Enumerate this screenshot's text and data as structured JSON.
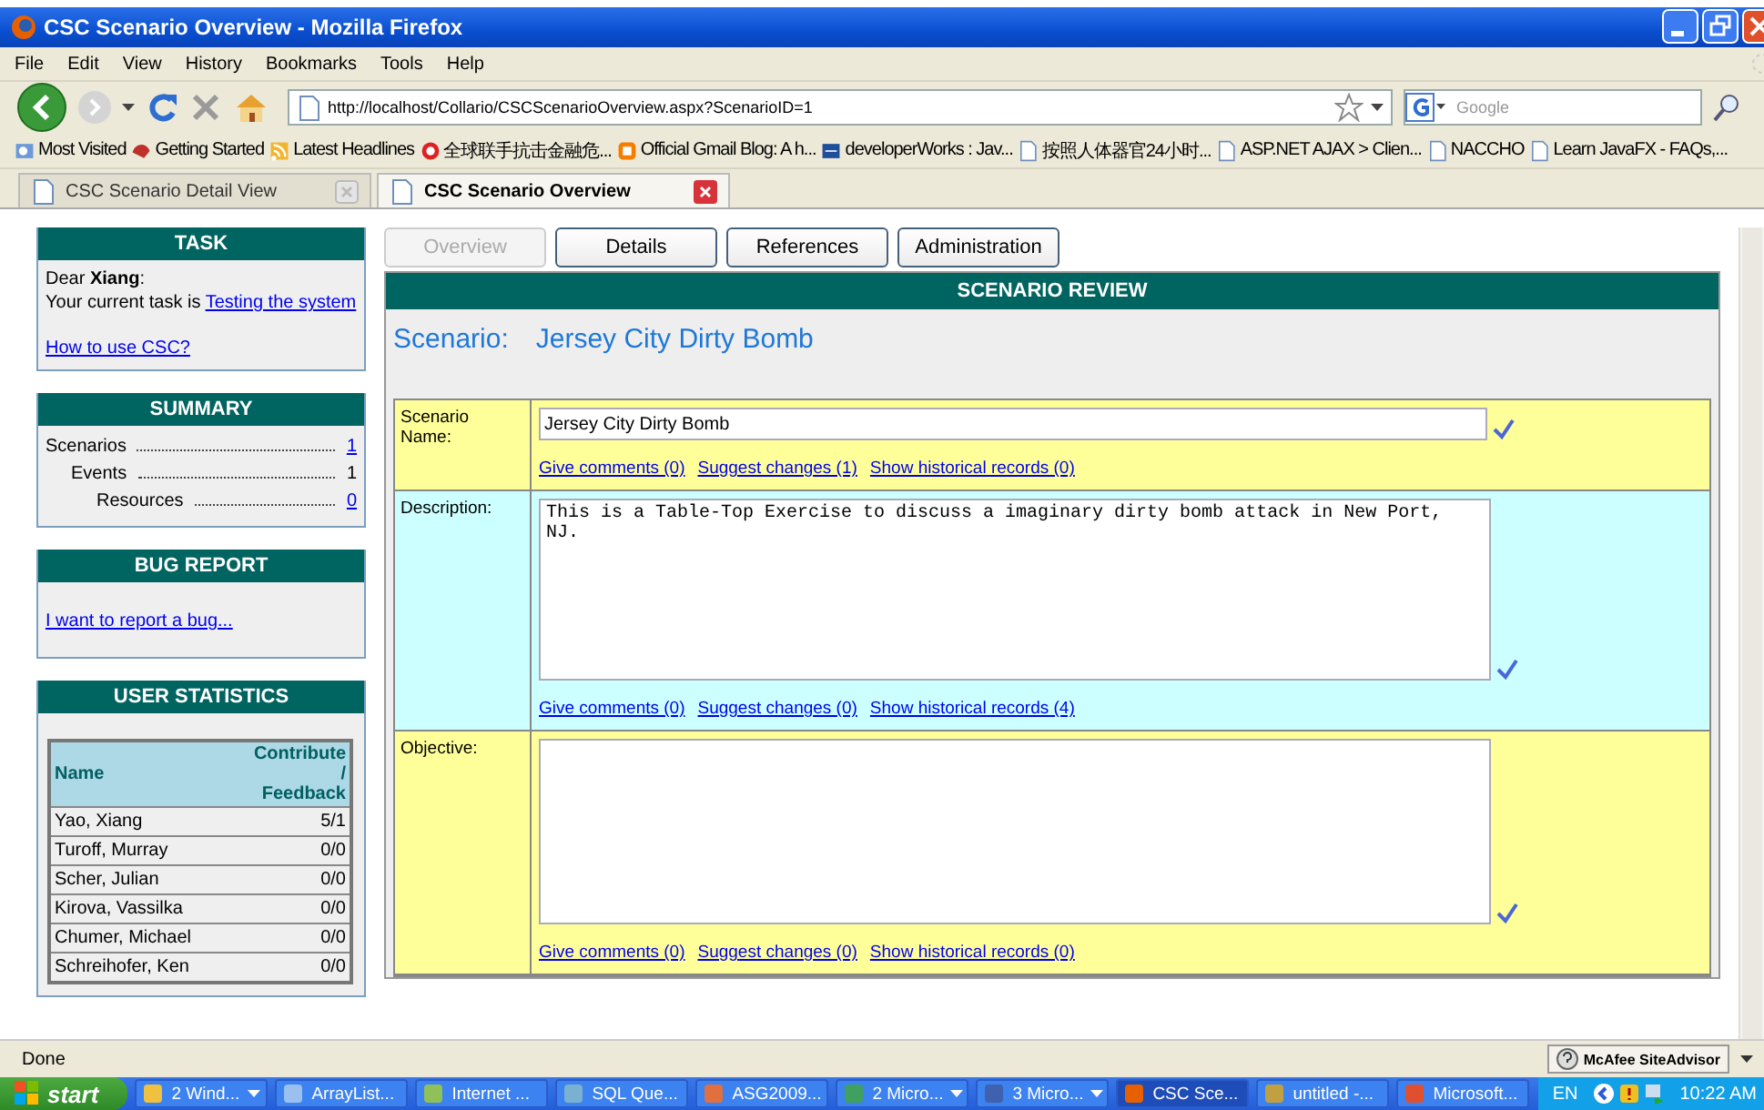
{
  "window": {
    "title": "CSC Scenario Overview - Mozilla Firefox"
  },
  "menu": [
    "File",
    "Edit",
    "View",
    "History",
    "Bookmarks",
    "Tools",
    "Help"
  ],
  "address": {
    "value": "http://localhost/Collario/CSCScenarioOverview.aspx?ScenarioID=1"
  },
  "search": {
    "placeholder": "Google"
  },
  "bookmarks": [
    "Most Visited",
    "Getting Started",
    "Latest Headlines",
    "全球联手抗击金融危...",
    "Official Gmail Blog: A h...",
    "developerWorks : Jav...",
    "按照人体器官24小时...",
    "ASP.NET AJAX > Clien...",
    "NACCHO",
    "Learn JavaFX - FAQs,..."
  ],
  "browser_tabs": [
    {
      "label": "CSC Scenario Detail View",
      "selected": false
    },
    {
      "label": "CSC Scenario Overview",
      "selected": true
    }
  ],
  "sidebar": {
    "task": {
      "title": "TASK",
      "greeting": "Dear **Xiang**:",
      "task_text": "Your current task is ",
      "task_link": "Testing the system",
      "help_link": "How to use CSC?"
    },
    "summary": {
      "title": "SUMMARY",
      "items": [
        {
          "label": "Scenarios",
          "value": "1",
          "link": true,
          "children": [
            {
              "label": "Events",
              "value": "1",
              "link": false,
              "children": [
                {
                  "label": "Resources",
                  "value": "0",
                  "link": true
                }
              ]
            }
          ]
        }
      ]
    },
    "bug_report": {
      "title": "BUG REPORT",
      "link": "I want to report a bug..."
    },
    "user_statistics": {
      "title": "USER STATISTICS",
      "columns": [
        "Name",
        "Contribute / Feedback"
      ],
      "rows": [
        [
          "Yao, Xiang",
          "5/1"
        ],
        [
          "Turoff, Murray",
          "0/0"
        ],
        [
          "Scher, Julian",
          "0/0"
        ],
        [
          "Kirova, Vassilka",
          "0/0"
        ],
        [
          "Chumer, Michael",
          "0/0"
        ],
        [
          "Schreihofer, Ken",
          "0/0"
        ]
      ]
    }
  },
  "page_tabs": [
    {
      "label": "Overview",
      "selected": true
    },
    {
      "label": "Details",
      "selected": false
    },
    {
      "label": "References",
      "selected": false
    },
    {
      "label": "Administration",
      "selected": false
    }
  ],
  "review": {
    "title": "SCENARIO REVIEW",
    "scenario_label": "Scenario:",
    "scenario_name": "Jersey City Dirty Bomb",
    "fields": [
      {
        "label": "Scenario Name:",
        "kind": "input",
        "color": "#ffff99",
        "value": "Jersey City Dirty Bomb",
        "links": [
          "Give comments (0)",
          "Suggest changes (1)",
          "Show historical records (0)"
        ]
      },
      {
        "label": "Description:",
        "kind": "textarea",
        "color": "#ccffff",
        "value": "This is a Table-Top Exercise to discuss a imaginary dirty bomb attack in New Port, NJ.",
        "links": [
          "Give comments (0)",
          "Suggest changes (0)",
          "Show historical records (4)"
        ]
      },
      {
        "label": "Objective:",
        "kind": "textarea",
        "color": "#ffff99",
        "links": [
          "Give comments (0)",
          "Suggest changes (0)",
          "Show historical records (0)"
        ]
      }
    ]
  },
  "status_bar": {
    "text": "Done",
    "addon": "McAfee SiteAdvisor"
  },
  "taskbar": {
    "start": "start",
    "items": [
      {
        "label": "2 Wind...",
        "grouped": true,
        "selected": false
      },
      {
        "label": "ArrayList...",
        "grouped": false,
        "selected": false
      },
      {
        "label": "Internet ...",
        "grouped": false,
        "selected": false
      },
      {
        "label": "SQL Que...",
        "grouped": false,
        "selected": false
      },
      {
        "label": "ASG2009...",
        "grouped": false,
        "selected": false
      },
      {
        "label": "2 Micro...",
        "grouped": true,
        "selected": false
      },
      {
        "label": "3 Micro...",
        "grouped": true,
        "selected": false
      },
      {
        "label": "CSC Sce...",
        "grouped": false,
        "selected": true
      },
      {
        "label": "untitled -...",
        "grouped": false,
        "selected": false
      },
      {
        "label": "Microsoft...",
        "grouped": false,
        "selected": false
      }
    ],
    "language": "EN",
    "clock": "10:22 AM"
  }
}
